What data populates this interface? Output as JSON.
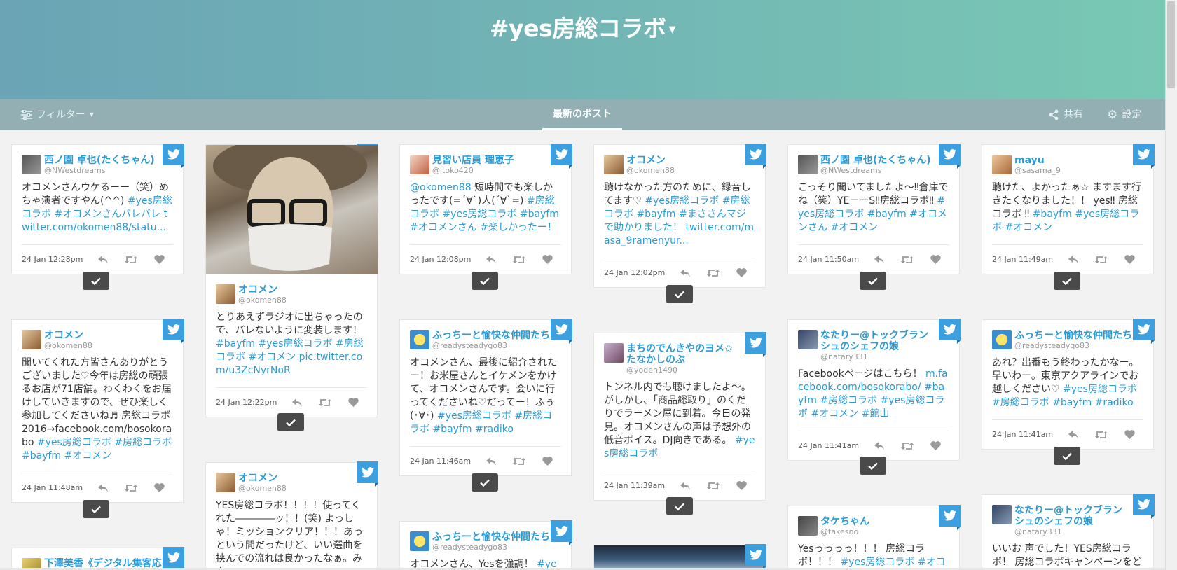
{
  "header": {
    "title": "#yes房総コラボ"
  },
  "nav": {
    "filter": "フィルター",
    "center": "最新のポスト",
    "share": "共有",
    "settings": "設定"
  },
  "cards": [
    {
      "name": "西ノ園 卓也(たくちゃん)",
      "handle": "@NWestdreams",
      "text": "オコメンさんウケるーー（笑）めちゃ演者ですやん(^^) #yes房総コラボ #オコメンさんバレバレ twitter.com/okomen88/statu...",
      "time": "24 Jan 12:28pm"
    },
    {
      "name": "オコメン",
      "handle": "@okomen88",
      "text": "とりあえずラジオに出ちゃったので、バレないように変装します！ #bayfm #yes房総コラボ #房総コラボ #オコメン pic.twitter.com/u3ZcNyrNoR",
      "time": "24 Jan 12:22pm"
    },
    {
      "name": "見習い店員 理恵子",
      "handle": "@itoko420",
      "text": "@okomen88 短時間でも楽しかったです(=´∀`)人(´∀`=) #房総コラボ #yes房総コラボ #bayfm #オコメンさん #楽しかったー！",
      "time": "24 Jan 12:08pm"
    },
    {
      "name": "オコメン",
      "handle": "@okomen88",
      "text": "聴けなかった方のために、録音してます♡ #yes房総コラボ #房総コラボ #bayfm #まささんマジで助かりました！ twitter.com/masa_9ramenyur...",
      "time": "24 Jan 12:02pm"
    },
    {
      "name": "西ノ園 卓也(たくちゃん)",
      "handle": "@NWestdreams",
      "text": "こっそり聞いてましたよ〜‼倉庫でね（笑）YEーーS‼房総コラボ‼ #yes房総コラボ #bayfm #オコメンさん #オコメン",
      "time": "24 Jan 11:50am"
    },
    {
      "name": "mayu",
      "handle": "@sasama_9",
      "text": "聴けた、よかったぁ☆ ますます行きたくなりました！！ yes‼ 房総コラボ ‼ #bayfm #yes房総コラボ #オコメン",
      "time": "24 Jan 11:49am"
    },
    {
      "name": "オコメン",
      "handle": "@okomen88",
      "text": "聞いてくれた方皆さんありがとうございました♡今年は房総の頑張るお店が71店舗。わくわくをお届けしていきますので、ぜひ楽しく参加してくださいね♬ 房総コラボ2016→facebook.com/bosokorabo #yes房総コラボ #房総コラボ #bayfm #オコメン",
      "time": "24 Jan 11:48am"
    },
    {
      "name": "ふっちーと愉快な仲間たち",
      "handle": "@readysteadygo83",
      "text": "オコメンさん、最後に紹介されたー！お米屋さんとイケメンをかけて、オコメンさんです。会いに行ってくださいね♡だってー！ふぅ(･∀･) #yes房総コラボ #房総コラボ #bayfm #radiko",
      "time": "24 Jan 11:46am"
    },
    {
      "name": "まちのでんきやのヨメ✩たなかしのぶ",
      "handle": "@yoden1490",
      "text": "トンネル内でも聴けましたよ〜。がしかし、「商品総取り」のくだりでラーメン屋に到着。今日の発見。オコメンさんの声は予想外の低音ボイス。DJ向きである。 #yes房総コラボ",
      "time": "24 Jan 11:39am"
    },
    {
      "name": "なたりー@トックブランシュのシェフの娘",
      "handle": "@natary331",
      "text": "Facebookページはこちら！ m.facebook.com/bosokorabo/ #bayfm #房総コラボ #yes房総コラボ #オコメン #館山",
      "time": "24 Jan 11:41am"
    },
    {
      "name": "ふっちーと愉快な仲間たち",
      "handle": "@readysteadygo83",
      "text": "あれ？出番もう終わったかなー。早いわー。東京アクアラインでお越しください♡ #yes房総コラボ #房総コラボ #bayfm #radiko",
      "time": "24 Jan 11:41am"
    },
    {
      "name": "下澤美香《デジタル集客応",
      "handle": "",
      "text": "",
      "time": ""
    },
    {
      "name": "オコメン",
      "handle": "@okomen88",
      "text": "YES房総コラボ！！！！使ってくれた――――ッ！！(笑) よっしゃ！ミッションクリア！！！あっという間だったけど、いい選曲を挟んでの流れは良かったなぁ。みん",
      "time": ""
    },
    {
      "name": "ふっちーと愉快な仲間たち",
      "handle": "@readysteadygo83",
      "text": "オコメンさん、Yesを強調！ #yes",
      "time": ""
    },
    {
      "name": "タケちゃん",
      "handle": "@takesno",
      "text": "Yesっっっっ！！！ 房総コラボ！！！ #yes房総コラボ #オコメ",
      "time": ""
    },
    {
      "name": "なたりー@トックブランシュのシェフの娘",
      "handle": "@natary331",
      "text": "いいお 声でした！YES房総コラボ！ 房総コラボキャンペーンをど",
      "time": ""
    }
  ],
  "colors": {
    "accent": "#2a9bd6",
    "twitter": "#3b9fe0",
    "check": "#4a4a4a"
  },
  "icons": [
    "twitter-icon",
    "reply-icon",
    "retweet-icon",
    "like-icon",
    "check-icon",
    "filter-icon",
    "share-icon",
    "gear-icon"
  ]
}
